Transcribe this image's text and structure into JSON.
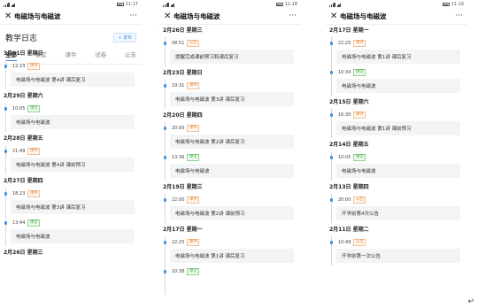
{
  "common": {
    "window_title": "电磁场与电磁波",
    "more": "···",
    "close": "✕"
  },
  "screens": [
    {
      "status_time": "11:17",
      "header_title": "教学日志",
      "publish_label": "+ 发布",
      "tabs": [
        "全部",
        "课堂",
        "课件",
        "试卷",
        "公告"
      ],
      "feed": [
        {
          "type": "date",
          "text": "3月01日  星期日"
        },
        {
          "type": "entry",
          "time": "12:23",
          "tag": "课件",
          "tag_color": "orange",
          "text": "电磁场与电磁波 第4讲 课后复习"
        },
        {
          "type": "date",
          "text": "2月29日  星期六"
        },
        {
          "type": "entry",
          "time": "10:05",
          "tag": "课堂",
          "tag_color": "green",
          "text": "电磁场与电磁波"
        },
        {
          "type": "date",
          "text": "2月28日  星期五"
        },
        {
          "type": "entry",
          "time": "21:49",
          "tag": "课件",
          "tag_color": "orange",
          "text": "电磁场与电磁波 第4讲 课前预习"
        },
        {
          "type": "date",
          "text": "2月27日  星期四"
        },
        {
          "type": "entry",
          "time": "18:23",
          "tag": "课件",
          "tag_color": "orange",
          "text": "电磁场与电磁波 第3讲 课后复习"
        },
        {
          "type": "entry",
          "time": "13:44",
          "tag": "课堂",
          "tag_color": "green",
          "text": "电磁场与电磁波"
        },
        {
          "type": "date",
          "text": "2月26日  星期三"
        }
      ]
    },
    {
      "status_time": "11:18",
      "feed": [
        {
          "type": "date",
          "text": "2月26日  星期三"
        },
        {
          "type": "entry",
          "time": "08:51",
          "tag": "公告",
          "tag_color": "orange",
          "text": "提醒完成课前预习和课后复习"
        },
        {
          "type": "date",
          "text": "2月23日  星期日"
        },
        {
          "type": "entry",
          "time": "19:31",
          "tag": "课件",
          "tag_color": "orange",
          "text": "电磁场与电磁波 第3讲 课后复习"
        },
        {
          "type": "date",
          "text": "2月20日  星期四"
        },
        {
          "type": "entry",
          "time": "20:00",
          "tag": "课件",
          "tag_color": "orange",
          "text": "电磁场与电磁波 第2讲 课后复习"
        },
        {
          "type": "entry",
          "time": "13:36",
          "tag": "课堂",
          "tag_color": "green",
          "text": "电磁场与电磁波"
        },
        {
          "type": "date",
          "text": "2月19日  星期三"
        },
        {
          "type": "entry",
          "time": "22:00",
          "tag": "课件",
          "tag_color": "orange",
          "text": "电磁场与电磁波 第2讲 课前预习"
        },
        {
          "type": "date",
          "text": "2月17日  星期一"
        },
        {
          "type": "entry",
          "time": "22:25",
          "tag": "课件",
          "tag_color": "orange",
          "text": "电磁场与电磁波 第1讲 课后复习"
        },
        {
          "type": "entry",
          "time": "10:38",
          "tag": "课堂",
          "tag_color": "green",
          "text": ""
        }
      ]
    },
    {
      "status_time": "11:19",
      "feed": [
        {
          "type": "date",
          "text": "2月17日  星期一"
        },
        {
          "type": "entry",
          "time": "22:25",
          "tag": "课件",
          "tag_color": "orange",
          "text": "电磁场与电磁波 第1讲 课后复习"
        },
        {
          "type": "entry",
          "time": "10:34",
          "tag": "课堂",
          "tag_color": "green",
          "text": "电磁场与电磁波"
        },
        {
          "type": "date",
          "text": "2月15日  星期六"
        },
        {
          "type": "entry",
          "time": "16:30",
          "tag": "课件",
          "tag_color": "orange",
          "text": "电磁场与电磁波 第1讲 课前预习"
        },
        {
          "type": "date",
          "text": "2月14日  星期五"
        },
        {
          "type": "entry",
          "time": "10:05",
          "tag": "课堂",
          "tag_color": "green",
          "text": "电磁场与电磁波"
        },
        {
          "type": "date",
          "text": "2月13日  星期四"
        },
        {
          "type": "entry",
          "time": "20:00",
          "tag": "公告",
          "tag_color": "orange",
          "text": "开学前第4次公告"
        },
        {
          "type": "date",
          "text": "2月11日  星期二"
        },
        {
          "type": "entry",
          "time": "10:49",
          "tag": "公告",
          "tag_color": "orange",
          "text": "开学前第一次公告"
        }
      ]
    }
  ],
  "corner_symbol": "↵"
}
